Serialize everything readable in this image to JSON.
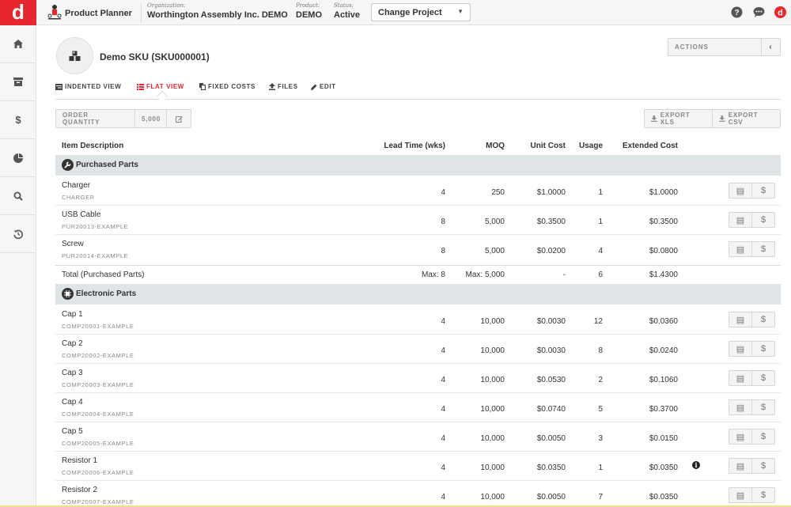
{
  "topbar": {
    "logo": "d",
    "app_name": "Product Planner",
    "organization_label": "Organization:",
    "organization_value": "Worthington Assembly Inc. DEMO",
    "product_label": "Product:",
    "product_value": "DEMO",
    "status_label": "Status:",
    "status_value": "Active",
    "change_project_label": "Change Project",
    "icons": [
      "help-icon",
      "chat-icon",
      "user-avatar"
    ],
    "brand_color": "#e8262e"
  },
  "sidebar": {
    "items": [
      {
        "icon": "home-icon"
      },
      {
        "icon": "inbox-icon"
      },
      {
        "icon": "dollar-icon"
      },
      {
        "icon": "pie-chart-icon"
      },
      {
        "icon": "search-icon"
      },
      {
        "icon": "history-icon"
      }
    ]
  },
  "header": {
    "title": "Demo SKU (SKU000001)",
    "actions_label": "ACTIONS"
  },
  "tabs": [
    {
      "label": "INDENTED VIEW",
      "icon": "list-icon"
    },
    {
      "label": "FLAT VIEW",
      "icon": "flat-list-icon",
      "active": true
    },
    {
      "label": "FIXED COSTS",
      "icon": "copy-icon"
    },
    {
      "label": "FILES",
      "icon": "upload-icon"
    },
    {
      "label": "EDIT",
      "icon": "pencil-icon"
    }
  ],
  "toolbar": {
    "order_quantity_label": "ORDER QUANTITY",
    "order_quantity_value": "5,000",
    "export_xls": "EXPORT XLS",
    "export_csv": "EXPORT CSV"
  },
  "table": {
    "columns": [
      "Item Description",
      "Lead Time (wks)",
      "MOQ",
      "Unit Cost",
      "Usage",
      "Extended Cost"
    ],
    "groups": [
      {
        "label": "Purchased Parts",
        "icon": "wrench-icon",
        "rows": [
          {
            "name": "Charger",
            "code": "CHARGER",
            "lead": "4",
            "moq": "250",
            "unit": "$1.0000",
            "usage": "1",
            "ext": "$1.0000"
          },
          {
            "name": "USB Cable",
            "code": "PUR20013-EXAMPLE",
            "lead": "8",
            "moq": "5,000",
            "unit": "$0.3500",
            "usage": "1",
            "ext": "$0.3500"
          },
          {
            "name": "Screw",
            "code": "PUR20014-EXAMPLE",
            "lead": "8",
            "moq": "5,000",
            "unit": "$0.0200",
            "usage": "4",
            "ext": "$0.0800"
          }
        ],
        "total": {
          "name": "Total (Purchased Parts)",
          "lead": "Max: 8",
          "moq": "Max: 5,000",
          "unit": "-",
          "usage": "6",
          "ext": "$1.4300"
        }
      },
      {
        "label": "Electronic Parts",
        "icon": "chip-icon",
        "rows": [
          {
            "name": "Cap 1",
            "code": "COMP20001-EXAMPLE",
            "lead": "4",
            "moq": "10,000",
            "unit": "$0.0030",
            "usage": "12",
            "ext": "$0.0360"
          },
          {
            "name": "Cap 2",
            "code": "COMP20002-EXAMPLE",
            "lead": "4",
            "moq": "10,000",
            "unit": "$0.0030",
            "usage": "8",
            "ext": "$0.0240"
          },
          {
            "name": "Cap 3",
            "code": "COMP20003-EXAMPLE",
            "lead": "4",
            "moq": "10,000",
            "unit": "$0.0530",
            "usage": "2",
            "ext": "$0.1060"
          },
          {
            "name": "Cap 4",
            "code": "COMP20004-EXAMPLE",
            "lead": "4",
            "moq": "10,000",
            "unit": "$0.0740",
            "usage": "5",
            "ext": "$0.3700"
          },
          {
            "name": "Cap 5",
            "code": "COMP20005-EXAMPLE",
            "lead": "4",
            "moq": "10,000",
            "unit": "$0.0050",
            "usage": "3",
            "ext": "$0.0150"
          },
          {
            "name": "Resistor 1",
            "code": "COMP20006-EXAMPLE",
            "lead": "4",
            "moq": "10,000",
            "unit": "$0.0350",
            "usage": "1",
            "ext": "$0.0350",
            "info": true
          },
          {
            "name": "Resistor 2",
            "code": "COMP20007-EXAMPLE",
            "lead": "4",
            "moq": "10,000",
            "unit": "$0.0050",
            "usage": "7",
            "ext": "$0.0350"
          }
        ]
      }
    ]
  }
}
